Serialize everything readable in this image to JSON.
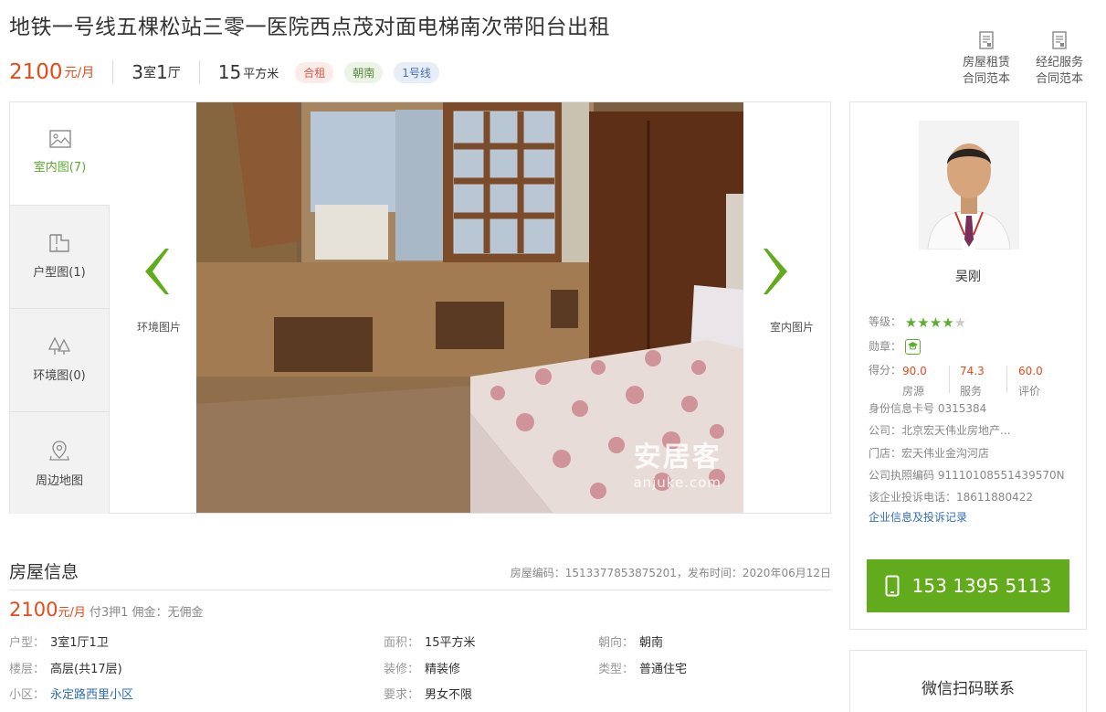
{
  "title": "地铁一号线五棵松站三零一医院西点茂对面电梯南次带阳台出租",
  "summary": {
    "price": "2100",
    "price_unit": "元/月",
    "rooms_num": "3",
    "rooms_label": "室",
    "halls_num": "1",
    "halls_label": "厅",
    "area_num": "15",
    "area_unit": "平方米",
    "tags": [
      "合租",
      "朝南",
      "1号线"
    ]
  },
  "contracts": [
    {
      "line1": "房屋租赁",
      "line2": "合同范本",
      "icon": "contract-document-icon"
    },
    {
      "line1": "经纪服务",
      "line2": "合同范本",
      "icon": "contract-document-icon"
    }
  ],
  "gallery": {
    "tabs": [
      {
        "label": "室内图(7)",
        "icon": "image-icon"
      },
      {
        "label": "户型图(1)",
        "icon": "floorplan-icon"
      },
      {
        "label": "环境图(0)",
        "icon": "trees-icon"
      },
      {
        "label": "周边地图",
        "icon": "map-pin-icon"
      }
    ],
    "prev_label": "环境图片",
    "next_label": "室内图片",
    "watermark_cn": "安居客",
    "watermark_en": "anjuke.com"
  },
  "agent": {
    "name": "吴刚",
    "level_label": "等级：",
    "rating_stars": 4.5,
    "medal_label": "勋章：",
    "score_label": "得分：",
    "scores": [
      {
        "value": "90.0",
        "label": "房源"
      },
      {
        "value": "74.3",
        "label": "服务"
      },
      {
        "value": "60.0",
        "label": "评价"
      }
    ],
    "id_card": "身份信息卡号 0315384",
    "company": "公司：北京宏天伟业房地产...",
    "store": "门店：宏天伟业金沟河店",
    "license": "公司执照编码 91110108551439570N",
    "complaint": "该企业投诉电话：18611880422",
    "link": "企业信息及投诉记录",
    "phone": "153 1395 5113"
  },
  "wechat_label": "微信扫码联系",
  "info": {
    "title": "房屋信息",
    "meta": "房屋编码：1513377853875201，发布时间：2020年06月12日",
    "price": "2100",
    "price_unit": "元/月",
    "payment": "付3押1 佣金：无佣金",
    "fields": {
      "layout_k": "户型：",
      "layout_v": "3室1厅1卫",
      "area_k": "面积：",
      "area_v": "15平方米",
      "orient_k": "朝向：",
      "orient_v": "朝南",
      "floor_k": "楼层：",
      "floor_v": "高层(共17层)",
      "deco_k": "装修：",
      "deco_v": "精装修",
      "type_k": "类型：",
      "type_v": "普通住宅",
      "community_k": "小区：",
      "community_v": "永定路西里小区",
      "req_k": "要求：",
      "req_v": "男女不限"
    }
  },
  "colors": {
    "accent_green": "#62ab1c",
    "price_orange": "#e54a1a",
    "link_blue": "#2f6fb8"
  }
}
